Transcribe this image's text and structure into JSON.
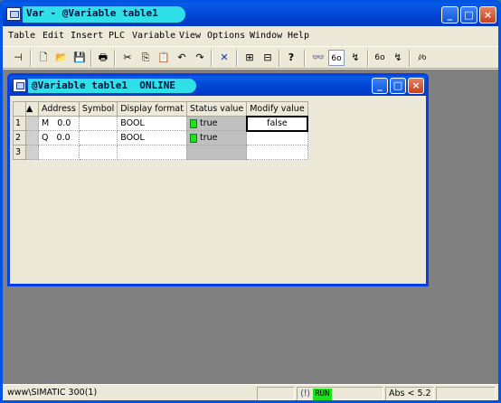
{
  "window": {
    "title": "Var - @Variable table1",
    "minimize": "_",
    "maximize": "□",
    "close": "×"
  },
  "menu": [
    "Table",
    "Edit",
    "Insert",
    "PLC",
    "Variable",
    "View",
    "Options",
    "Window",
    "Help"
  ],
  "toolbar": {
    "icons": [
      "pin-icon",
      "new-icon",
      "open-icon",
      "save-icon",
      "print-icon",
      "cut-icon",
      "copy-icon",
      "paste-icon",
      "undo-icon",
      "redo-icon",
      "delete-icon",
      "network-icon",
      "accessible-nodes-icon",
      "help-icon",
      "monitor-icon",
      "monitor-variable-icon",
      "modify-variable-icon",
      "update-monitor-icon",
      "update-modify-icon",
      "force-icon"
    ],
    "glyphs": [
      "⊣",
      "🗋",
      "📂",
      "💾",
      "🖶",
      "✂",
      "⎘",
      "📋",
      "↶",
      "↷",
      "✕",
      "⊞",
      "⊟",
      "?",
      "👓",
      "6o",
      "↯",
      "6o",
      "↯",
      "/⁄o"
    ]
  },
  "child": {
    "title": "@Variable table1  ONLINE",
    "minimize": "_",
    "maximize": "□",
    "close": "×"
  },
  "table": {
    "headers": [
      "Address",
      "Symbol",
      "Display format",
      "Status value",
      "Modify value"
    ],
    "rows": [
      {
        "num": "1",
        "area": "M",
        "offset": "0.0",
        "symbol": "",
        "format": "BOOL",
        "status": "true",
        "modify": "false"
      },
      {
        "num": "2",
        "area": "Q",
        "offset": "0.0",
        "symbol": "",
        "format": "BOOL",
        "status": "true",
        "modify": ""
      },
      {
        "num": "3",
        "area": "",
        "offset": "",
        "symbol": "",
        "format": "",
        "status": "",
        "modify": ""
      }
    ]
  },
  "statusbar": {
    "path": "www\\SIMATIC 300(1)",
    "run": "RUN",
    "mode": "Abs < 5.2"
  },
  "colors": {
    "title_blue": "#0046d5",
    "title_pill": "#2fe0e8",
    "run_green": "#20e020",
    "mdi_gray": "#808080"
  }
}
